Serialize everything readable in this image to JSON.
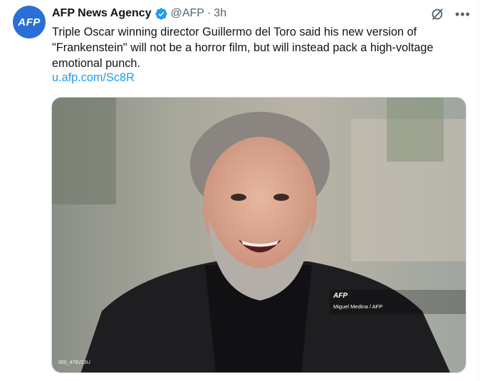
{
  "tweet": {
    "author_name": "AFP News Agency",
    "handle": "@AFP",
    "separator": "·",
    "time": "3h",
    "avatar_text": "AFP",
    "text_lines": [
      "Triple Oscar winning director Guillermo del Toro said his new version of",
      "\"Frankenstein\" will not be a horror film, but will instead pack a high-voltage",
      "emotional punch."
    ],
    "link": "u.afp.com/Sc8R"
  },
  "media": {
    "watermark": "AFP",
    "credit": "Miguel Medina / AFP",
    "photo_code": "000_476V23U"
  },
  "icons": {
    "verified": "verified-badge-icon",
    "grok": "grok-icon",
    "more": "more-icon"
  },
  "colors": {
    "accent": "#1d9bf0",
    "avatar_bg": "#2b6fd6",
    "muted_text": "#536471"
  }
}
